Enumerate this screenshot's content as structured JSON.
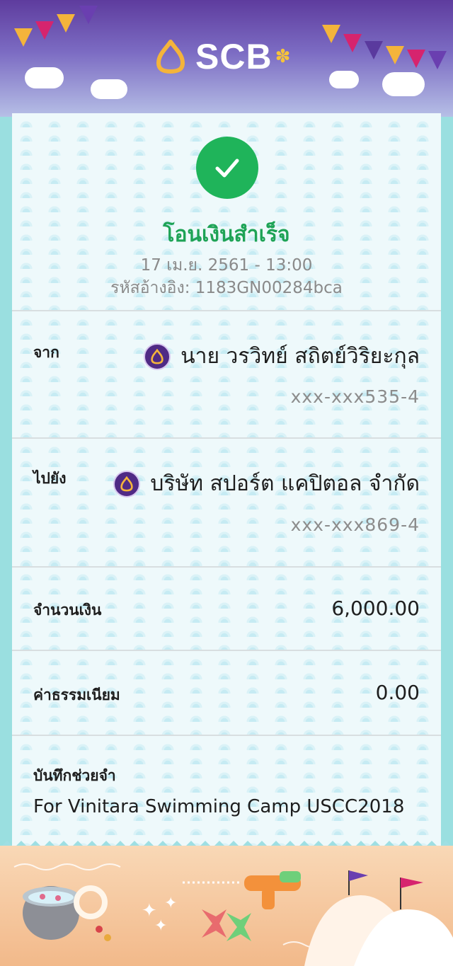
{
  "brand": {
    "name": "SCB",
    "accent": "#5b2d8e",
    "gold": "#f4b43b"
  },
  "receipt": {
    "status_title": "โอนเงินสำเร็จ",
    "datetime": "17 เม.ย. 2561 - 13:00",
    "reference_label": "รหัสอ้างอิง:",
    "reference_value": "1183GN00284bca",
    "success_color": "#1fb45a"
  },
  "from": {
    "label": "จาก",
    "name": "นาย วรวิทย์ สถิตย์วิริยะกุล",
    "account": "xxx-xxx535-4",
    "bank_icon": "scb-logo-icon"
  },
  "to": {
    "label": "ไปยัง",
    "name": "บริษัท สปอร์ต แคปิตอล จำกัด",
    "account": "xxx-xxx869-4",
    "bank_icon": "scb-logo-icon"
  },
  "amount": {
    "label": "จำนวนเงิน",
    "value": "6,000.00"
  },
  "fee": {
    "label": "ค่าธรรมเนียม",
    "value": "0.00"
  },
  "memo": {
    "label": "บันทึกช่วยจำ",
    "value": "For Vinitara Swimming Camp USCC2018"
  }
}
